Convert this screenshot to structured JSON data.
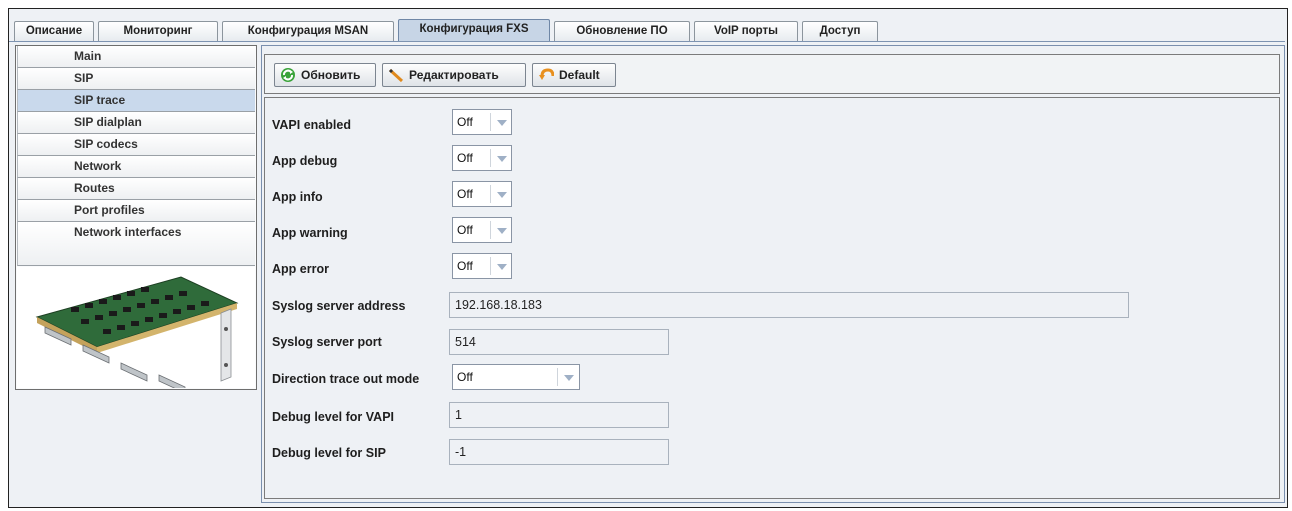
{
  "tabs": [
    {
      "label": "Описание"
    },
    {
      "label": "Мониторинг"
    },
    {
      "label": "Конфигурация MSAN"
    },
    {
      "label": "Конфигурация FXS"
    },
    {
      "label": "Обновление ПО"
    },
    {
      "label": "VoIP порты"
    },
    {
      "label": "Доступ"
    }
  ],
  "active_tab": "Конфигурация FXS",
  "sidebar": {
    "items": [
      {
        "label": "Main"
      },
      {
        "label": "SIP"
      },
      {
        "label": "SIP trace"
      },
      {
        "label": "SIP dialplan"
      },
      {
        "label": "SIP codecs"
      },
      {
        "label": "Network"
      },
      {
        "label": "Routes"
      },
      {
        "label": "Port profiles"
      },
      {
        "label": "Network interfaces"
      }
    ],
    "selected": "SIP trace"
  },
  "toolbar": {
    "refresh_label": "Обновить",
    "edit_label": "Редактировать",
    "default_label": "Default"
  },
  "form": {
    "vapi_enabled": {
      "label": "VAPI enabled",
      "value": "Off"
    },
    "app_debug": {
      "label": "App debug",
      "value": "Off"
    },
    "app_info": {
      "label": "App info",
      "value": "Off"
    },
    "app_warning": {
      "label": "App warning",
      "value": "Off"
    },
    "app_error": {
      "label": "App error",
      "value": "Off"
    },
    "syslog_address": {
      "label": "Syslog server address",
      "value": "192.168.18.183"
    },
    "syslog_port": {
      "label": "Syslog server port",
      "value": "514"
    },
    "direction_trace": {
      "label": "Direction trace out mode",
      "value": "Off"
    },
    "debug_vapi": {
      "label": "Debug level for VAPI",
      "value": "1"
    },
    "debug_sip": {
      "label": "Debug level for SIP",
      "value": "-1"
    }
  },
  "colors": {
    "selected_bg": "#c9d9ec",
    "panel_bg": "#eef1f5",
    "border_blue": "#7a8fae"
  }
}
